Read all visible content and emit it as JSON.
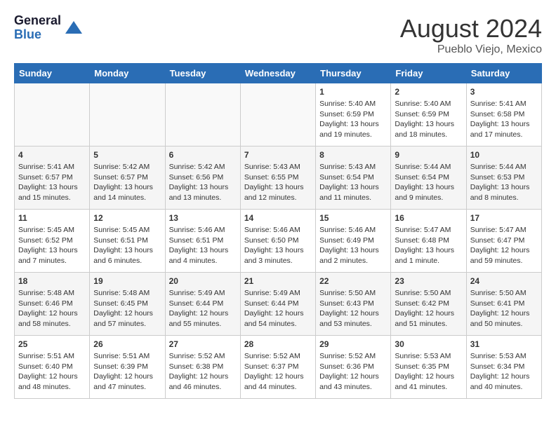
{
  "header": {
    "logo_general": "General",
    "logo_blue": "Blue",
    "title": "August 2024",
    "location": "Pueblo Viejo, Mexico"
  },
  "days_of_week": [
    "Sunday",
    "Monday",
    "Tuesday",
    "Wednesday",
    "Thursday",
    "Friday",
    "Saturday"
  ],
  "weeks": [
    [
      {
        "day": "",
        "info": ""
      },
      {
        "day": "",
        "info": ""
      },
      {
        "day": "",
        "info": ""
      },
      {
        "day": "",
        "info": ""
      },
      {
        "day": "1",
        "info": "Sunrise: 5:40 AM\nSunset: 6:59 PM\nDaylight: 13 hours\nand 19 minutes."
      },
      {
        "day": "2",
        "info": "Sunrise: 5:40 AM\nSunset: 6:59 PM\nDaylight: 13 hours\nand 18 minutes."
      },
      {
        "day": "3",
        "info": "Sunrise: 5:41 AM\nSunset: 6:58 PM\nDaylight: 13 hours\nand 17 minutes."
      }
    ],
    [
      {
        "day": "4",
        "info": "Sunrise: 5:41 AM\nSunset: 6:57 PM\nDaylight: 13 hours\nand 15 minutes."
      },
      {
        "day": "5",
        "info": "Sunrise: 5:42 AM\nSunset: 6:57 PM\nDaylight: 13 hours\nand 14 minutes."
      },
      {
        "day": "6",
        "info": "Sunrise: 5:42 AM\nSunset: 6:56 PM\nDaylight: 13 hours\nand 13 minutes."
      },
      {
        "day": "7",
        "info": "Sunrise: 5:43 AM\nSunset: 6:55 PM\nDaylight: 13 hours\nand 12 minutes."
      },
      {
        "day": "8",
        "info": "Sunrise: 5:43 AM\nSunset: 6:54 PM\nDaylight: 13 hours\nand 11 minutes."
      },
      {
        "day": "9",
        "info": "Sunrise: 5:44 AM\nSunset: 6:54 PM\nDaylight: 13 hours\nand 9 minutes."
      },
      {
        "day": "10",
        "info": "Sunrise: 5:44 AM\nSunset: 6:53 PM\nDaylight: 13 hours\nand 8 minutes."
      }
    ],
    [
      {
        "day": "11",
        "info": "Sunrise: 5:45 AM\nSunset: 6:52 PM\nDaylight: 13 hours\nand 7 minutes."
      },
      {
        "day": "12",
        "info": "Sunrise: 5:45 AM\nSunset: 6:51 PM\nDaylight: 13 hours\nand 6 minutes."
      },
      {
        "day": "13",
        "info": "Sunrise: 5:46 AM\nSunset: 6:51 PM\nDaylight: 13 hours\nand 4 minutes."
      },
      {
        "day": "14",
        "info": "Sunrise: 5:46 AM\nSunset: 6:50 PM\nDaylight: 13 hours\nand 3 minutes."
      },
      {
        "day": "15",
        "info": "Sunrise: 5:46 AM\nSunset: 6:49 PM\nDaylight: 13 hours\nand 2 minutes."
      },
      {
        "day": "16",
        "info": "Sunrise: 5:47 AM\nSunset: 6:48 PM\nDaylight: 13 hours\nand 1 minute."
      },
      {
        "day": "17",
        "info": "Sunrise: 5:47 AM\nSunset: 6:47 PM\nDaylight: 12 hours\nand 59 minutes."
      }
    ],
    [
      {
        "day": "18",
        "info": "Sunrise: 5:48 AM\nSunset: 6:46 PM\nDaylight: 12 hours\nand 58 minutes."
      },
      {
        "day": "19",
        "info": "Sunrise: 5:48 AM\nSunset: 6:45 PM\nDaylight: 12 hours\nand 57 minutes."
      },
      {
        "day": "20",
        "info": "Sunrise: 5:49 AM\nSunset: 6:44 PM\nDaylight: 12 hours\nand 55 minutes."
      },
      {
        "day": "21",
        "info": "Sunrise: 5:49 AM\nSunset: 6:44 PM\nDaylight: 12 hours\nand 54 minutes."
      },
      {
        "day": "22",
        "info": "Sunrise: 5:50 AM\nSunset: 6:43 PM\nDaylight: 12 hours\nand 53 minutes."
      },
      {
        "day": "23",
        "info": "Sunrise: 5:50 AM\nSunset: 6:42 PM\nDaylight: 12 hours\nand 51 minutes."
      },
      {
        "day": "24",
        "info": "Sunrise: 5:50 AM\nSunset: 6:41 PM\nDaylight: 12 hours\nand 50 minutes."
      }
    ],
    [
      {
        "day": "25",
        "info": "Sunrise: 5:51 AM\nSunset: 6:40 PM\nDaylight: 12 hours\nand 48 minutes."
      },
      {
        "day": "26",
        "info": "Sunrise: 5:51 AM\nSunset: 6:39 PM\nDaylight: 12 hours\nand 47 minutes."
      },
      {
        "day": "27",
        "info": "Sunrise: 5:52 AM\nSunset: 6:38 PM\nDaylight: 12 hours\nand 46 minutes."
      },
      {
        "day": "28",
        "info": "Sunrise: 5:52 AM\nSunset: 6:37 PM\nDaylight: 12 hours\nand 44 minutes."
      },
      {
        "day": "29",
        "info": "Sunrise: 5:52 AM\nSunset: 6:36 PM\nDaylight: 12 hours\nand 43 minutes."
      },
      {
        "day": "30",
        "info": "Sunrise: 5:53 AM\nSunset: 6:35 PM\nDaylight: 12 hours\nand 41 minutes."
      },
      {
        "day": "31",
        "info": "Sunrise: 5:53 AM\nSunset: 6:34 PM\nDaylight: 12 hours\nand 40 minutes."
      }
    ]
  ]
}
